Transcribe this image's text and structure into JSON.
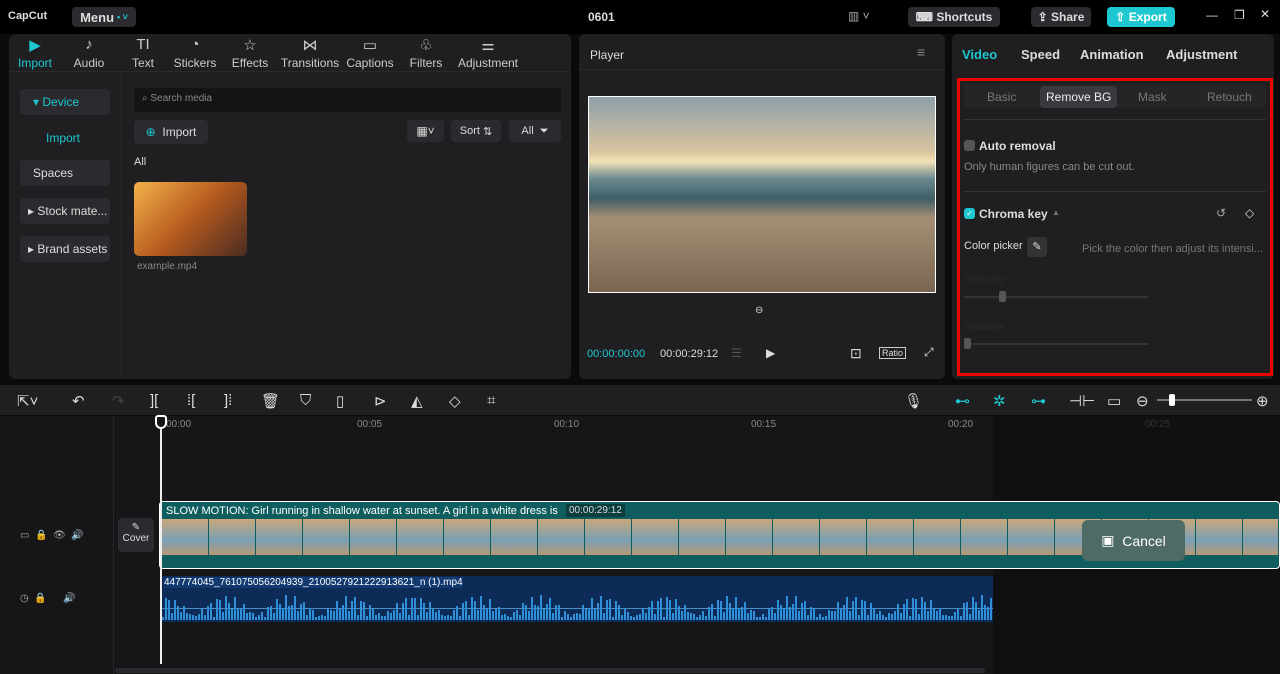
{
  "app": {
    "logo": "CapCut",
    "menu": "Menu",
    "title": "0601",
    "shortcuts": "Shortcuts",
    "share": "Share",
    "export": "Export"
  },
  "media_tabs": [
    {
      "icon": "▶",
      "label": "Import"
    },
    {
      "icon": "♪",
      "label": "Audio"
    },
    {
      "icon": "TI",
      "label": "Text"
    },
    {
      "icon": "◔",
      "label": "Stickers"
    },
    {
      "icon": "☆",
      "label": "Effects"
    },
    {
      "icon": "⋈",
      "label": "Transitions"
    },
    {
      "icon": "▭",
      "label": "Captions"
    },
    {
      "icon": "♧",
      "label": "Filters"
    },
    {
      "icon": "⚌",
      "label": "Adjustment"
    }
  ],
  "sidebar": {
    "device": "Device",
    "import": "Import",
    "spaces": "Spaces",
    "stock": "Stock mate...",
    "brand": "Brand assets"
  },
  "media": {
    "search_placeholder": "Search media",
    "import": "Import",
    "sort": "Sort",
    "all_filter": "All",
    "all_label": "All",
    "file": "example.mp4"
  },
  "player": {
    "title": "Player",
    "current": "00:00:00:00",
    "total": "00:00:29:12",
    "ratio": "Ratio"
  },
  "props": {
    "tabs": [
      "Video",
      "Speed",
      "Animation",
      "Adjustment"
    ],
    "subtabs": [
      "Basic",
      "Remove BG",
      "Mask",
      "Retouch"
    ],
    "auto_removal": "Auto removal",
    "auto_hint": "Only human figures can be cut out.",
    "chroma_key": "Chroma key",
    "chroma_checked": true,
    "color_picker": "Color picker",
    "picker_hint": "Pick the color then adjust its intensi...",
    "intensity": "Intensity",
    "shadow": "Shadow"
  },
  "timeline": {
    "ticks": [
      "00:00",
      "00:05",
      "00:10",
      "00:15",
      "00:20",
      "00:25"
    ],
    "cover": "Cover",
    "clip_title": "SLOW MOTION: Girl running in shallow water at sunset. A girl in a white dress is",
    "clip_duration": "00:00:29:12",
    "audio_name": "447774045_761075056204939_2100527921222913621_n (1).mp4",
    "cancel": "Cancel"
  }
}
